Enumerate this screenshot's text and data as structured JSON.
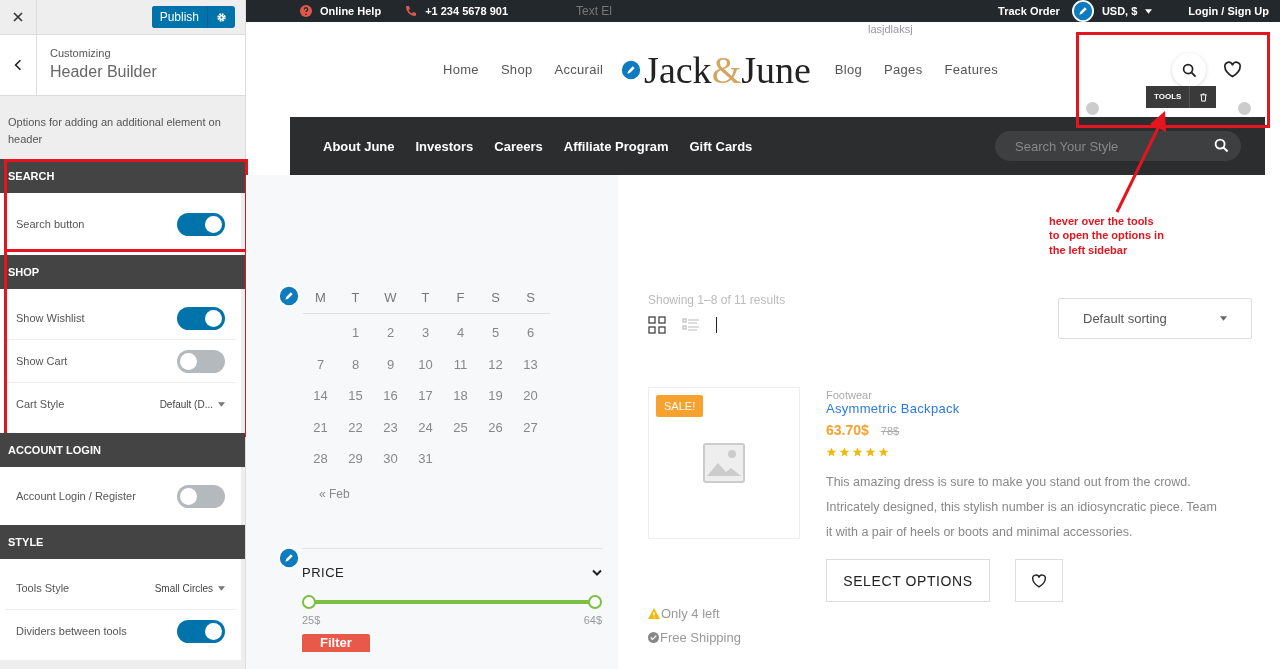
{
  "sidebar": {
    "publish_button": "Publish",
    "eyebrow": "Customizing",
    "title": "Header Builder",
    "description": "Options for adding an additional element on header",
    "sections": [
      {
        "title": "SEARCH",
        "highlighted": true,
        "rows": [
          {
            "kind": "toggle",
            "label": "Search button",
            "on": true
          }
        ]
      },
      {
        "title": "SHOP",
        "highlighted": true,
        "rows": [
          {
            "kind": "toggle",
            "label": "Show Wishlist",
            "on": true
          },
          {
            "kind": "toggle",
            "label": "Show Cart",
            "on": false
          },
          {
            "kind": "select",
            "label": "Cart Style",
            "value": "Default (D..."
          }
        ]
      },
      {
        "title": "ACCOUNT LOGIN",
        "highlighted": false,
        "rows": [
          {
            "kind": "toggle",
            "label": "Account Login / Register",
            "on": false
          }
        ]
      },
      {
        "title": "STYLE",
        "highlighted": false,
        "rows": [
          {
            "kind": "select",
            "label": "Tools Style",
            "value": "Small Circles"
          },
          {
            "kind": "toggle",
            "label": "Dividers between tools",
            "on": true
          }
        ]
      }
    ]
  },
  "topbar": {
    "help": "Online Help",
    "phone": "+1 234 5678 901",
    "text_element": "Text El",
    "overflow_text": "lasjdlaksj",
    "track_order": "Track Order",
    "currency": "USD, $",
    "login": "Login / Sign Up"
  },
  "header": {
    "nav_left": [
      "Home",
      "Shop",
      "Accurail"
    ],
    "logo": {
      "first": "Jack",
      "amp": "&",
      "last": "June"
    },
    "nav_right": [
      "Blog",
      "Pages",
      "Features"
    ],
    "tools_label": "TOOLS",
    "highlighted": true
  },
  "navbar": {
    "items": [
      "About June",
      "Investors",
      "Careers",
      "Affiliate Program",
      "Gift Cards"
    ],
    "search": {
      "placeholder": "Search Your Style"
    }
  },
  "calendar": {
    "weekdays": [
      "M",
      "T",
      "W",
      "T",
      "F",
      "S",
      "S"
    ],
    "weeks": [
      [
        "1",
        "2",
        "3",
        "4",
        "5",
        "6"
      ],
      [
        "7",
        "8",
        "9",
        "10",
        "11",
        "12",
        "13"
      ],
      [
        "14",
        "15",
        "16",
        "17",
        "18",
        "19",
        "20"
      ],
      [
        "21",
        "22",
        "23",
        "24",
        "25",
        "26",
        "27"
      ],
      [
        "28",
        "29",
        "30",
        "31"
      ]
    ],
    "prev": "« Feb"
  },
  "price_filter": {
    "title": "PRICE",
    "level": 1,
    "min": "25$",
    "max": "64$",
    "button": "Filter"
  },
  "results": {
    "count": "Showing 1–8 of 11 results",
    "sorting": "Default sorting"
  },
  "product": {
    "badge": "SALE!",
    "category": "Footwear",
    "name": "Asymmetric Backpack",
    "price": "63.70$",
    "old_price": "78$",
    "stars": 5,
    "description": "This amazing dress is sure to make you stand out from the crowd. Intricately designed, this stylish number is an idiosyncratic piece. Team it with a pair of heels or boots and minimal accessories.",
    "button": "SELECT OPTIONS",
    "stock": "Only 4 left",
    "shipping": "Free Shipping"
  },
  "annotation": {
    "lines": [
      "hever over the tools",
      "to open the options in",
      "the left sidebar"
    ]
  }
}
